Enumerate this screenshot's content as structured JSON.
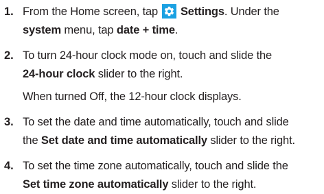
{
  "steps": [
    {
      "number": "1.",
      "line1_pre": "From the Home screen, tap",
      "icon_name": "gear-icon",
      "line1_bold": "Settings",
      "line1_post": ". Under the",
      "line2_bold1": "system",
      "line2_mid": " menu, tap ",
      "line2_bold2": "date + time",
      "line2_post": "."
    },
    {
      "number": "2.",
      "line1": "To turn 24-hour clock mode on, touch and slide the",
      "line2_bold": "24-hour clock",
      "line2_post": " slider to the right.",
      "note": "When turned Off, the 12-hour clock displays."
    },
    {
      "number": "3.",
      "line1": "To set the date and time automatically, touch and slide",
      "line2_pre": "the ",
      "line2_bold": "Set date and time automatically",
      "line2_post": " slider to the right."
    },
    {
      "number": "4.",
      "line1": "To set the time zone automatically, touch and slide the",
      "line2_bold": "Set time zone automatically",
      "line2_post": " slider to the right."
    }
  ],
  "colors": {
    "text": "#231f20",
    "settings_tile": "#1ba1e2"
  }
}
